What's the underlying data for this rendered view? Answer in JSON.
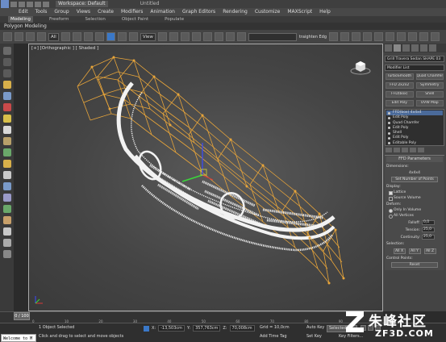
{
  "title_bar": {
    "workspace": "Workspace: Default",
    "app_title": "Untitled"
  },
  "menubar": [
    "Edit",
    "Tools",
    "Group",
    "Views",
    "Create",
    "Modifiers",
    "Animation",
    "Graph Editors",
    "Rendering",
    "Customize",
    "MAXScript",
    "Help"
  ],
  "ribbon": {
    "tabs": [
      "Modeling",
      "Freeform",
      "Selection",
      "Object Paint",
      "Populate"
    ],
    "active_tab": "Modeling",
    "sub_label": "Polygon Modeling"
  },
  "toolbar": {
    "filter_value": "All",
    "view_value": "View",
    "snap_label": "3",
    "selection_set_placeholder": "",
    "straighten_label": "traighten Edg"
  },
  "viewport": {
    "label": "[+] [Orthographic ] [ Shaded ]"
  },
  "command_panel": {
    "object_name": "Grill Travera Sedan SHAPE 03",
    "modifier_list": "Modifier List",
    "buttons": [
      "TurboSmooth",
      "Quad Chamfer",
      "FFD 2x2x2",
      "Symmetry",
      "FFD(box)",
      "Shell",
      "Edit Poly",
      "UVW Map"
    ],
    "stack": [
      {
        "label": "FFD(box) 4x4x4",
        "sel": true,
        "sub": false
      },
      {
        "label": "Edit Poly",
        "sel": false,
        "sub": false
      },
      {
        "label": "Quad Chamfer",
        "sel": false,
        "sub": false
      },
      {
        "label": "Edit Poly",
        "sel": false,
        "sub": false
      },
      {
        "label": "Shell",
        "sel": false,
        "sub": false
      },
      {
        "label": "Edit Poly",
        "sel": false,
        "sub": false
      },
      {
        "label": "Editable Poly",
        "sel": false,
        "sub": false
      }
    ],
    "ffd": {
      "header": "FFD Parameters",
      "dimensions_label": "Dimensions:",
      "dimensions_value": "4x4x4",
      "set_points": "Set Number of Points",
      "display_label": "Display:",
      "lattice": "Lattice",
      "source_volume": "Source Volume",
      "deform_label": "Deform:",
      "only_in_volume": "Only In Volume",
      "all_vertices": "All Vertices",
      "falloff_label": "Falloff:",
      "falloff_value": "0,0",
      "tension_label": "Tension:",
      "tension_value": "25,0",
      "continuity_label": "Continuity:",
      "continuity_value": "25,0",
      "selection_label": "Selection:",
      "all_x": "All X",
      "all_y": "All Y",
      "all_z": "All Z",
      "control_points_label": "Control Points:",
      "reset": "Reset"
    }
  },
  "timeline": {
    "frame": "0 / 100",
    "ticks": [
      "0",
      "10",
      "20",
      "30",
      "40",
      "50",
      "60",
      "70",
      "80",
      "90",
      "100"
    ]
  },
  "status_bar": {
    "maxscript": "Welcome to M",
    "selection": "1 Object Selected",
    "prompt": "Click and drag to select and move objects",
    "x_label": "X:",
    "x_value": "-13,503cm",
    "y_label": "Y:",
    "y_value": "357,763cm",
    "z_label": "Z:",
    "z_value": "70,008cm",
    "grid": "Grid = 10,0cm",
    "add_time_tag": "Add Time Tag",
    "auto_key": "Auto Key",
    "set_key": "Set Key",
    "selected": "Selected",
    "key_filters": "Key Filters..."
  },
  "watermark": {
    "cn": "朱峰社区",
    "en": "ZF3D.COM"
  },
  "colors": {
    "lattice": "#e8a53a",
    "grill": "#f2f2f2",
    "accent": "#3a78c8"
  }
}
